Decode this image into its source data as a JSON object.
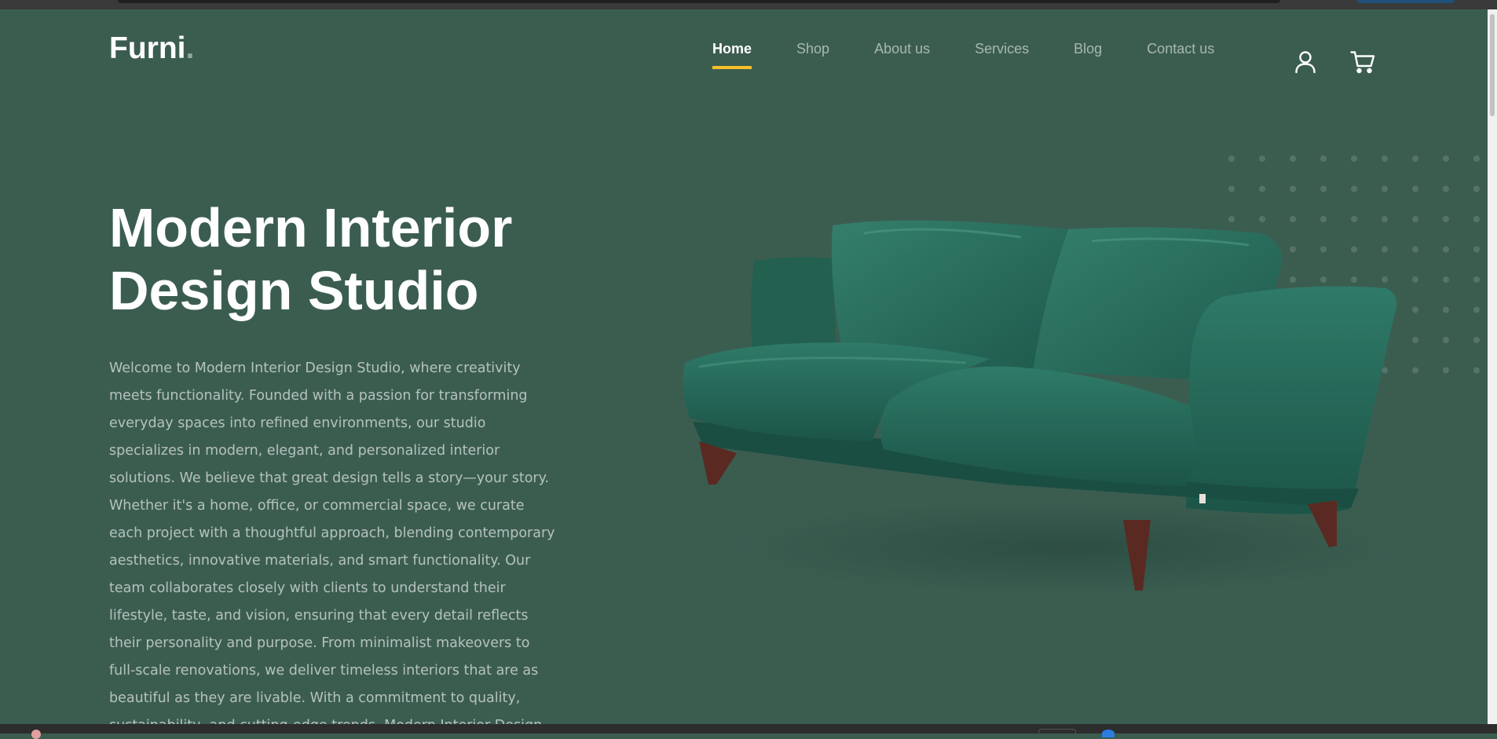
{
  "brand": {
    "name": "Furni",
    "dot": "."
  },
  "nav": {
    "items": [
      {
        "label": "Home",
        "active": true
      },
      {
        "label": "Shop",
        "active": false
      },
      {
        "label": "About us",
        "active": false
      },
      {
        "label": "Services",
        "active": false
      },
      {
        "label": "Blog",
        "active": false
      },
      {
        "label": "Contact us",
        "active": false
      }
    ],
    "user_icon": "user-icon",
    "cart_icon": "cart-icon"
  },
  "hero": {
    "title_line1": "Modern Interior",
    "title_line2": "Design Studio",
    "description": "Welcome to Modern Interior Design Studio, where creativity meets functionality. Founded with a passion for transforming everyday spaces into refined environments, our studio specializes in modern, elegant, and personalized interior solutions. We believe that great design tells a story—your story. Whether it's a home, office, or commercial space, we curate each project with a thoughtful approach, blending contemporary aesthetics, innovative materials, and smart functionality. Our team collaborates closely with clients to understand their lifestyle, taste, and vision, ensuring that every detail reflects their personality and purpose. From minimalist makeovers to full-scale renovations, we deliver timeless interiors that are as beautiful as they are livable. With a commitment to quality, sustainability, and cutting-edge trends, Modern Interior Design Studio brings life to spaces with clarity, sophistication, and",
    "image": "green-velvet-sofa"
  },
  "colors": {
    "background": "#3b5d50",
    "accent": "#f9bf29",
    "text": "#ffffff"
  }
}
